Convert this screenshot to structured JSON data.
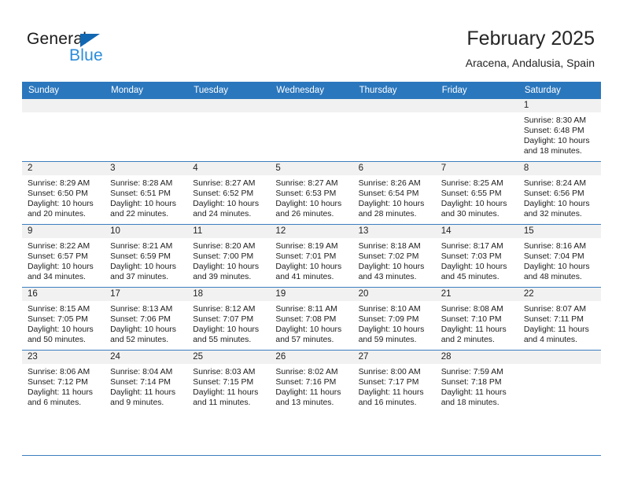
{
  "brand": {
    "name_part1": "General",
    "name_part2": "Blue",
    "triangle_color": "#1267b2",
    "blue_color": "#2a8cdb"
  },
  "header": {
    "title": "February 2025",
    "subtitle": "Aracena, Andalusia, Spain"
  },
  "theme": {
    "header_bg": "#2b77bd",
    "daynum_bg": "#f1f1f1",
    "grid_line": "#3d7fbf"
  },
  "weekdays": [
    "Sunday",
    "Monday",
    "Tuesday",
    "Wednesday",
    "Thursday",
    "Friday",
    "Saturday"
  ],
  "weeks": [
    [
      {
        "day": "",
        "sunrise": "",
        "sunset": "",
        "daylight_line1": "",
        "daylight_line2": ""
      },
      {
        "day": "",
        "sunrise": "",
        "sunset": "",
        "daylight_line1": "",
        "daylight_line2": ""
      },
      {
        "day": "",
        "sunrise": "",
        "sunset": "",
        "daylight_line1": "",
        "daylight_line2": ""
      },
      {
        "day": "",
        "sunrise": "",
        "sunset": "",
        "daylight_line1": "",
        "daylight_line2": ""
      },
      {
        "day": "",
        "sunrise": "",
        "sunset": "",
        "daylight_line1": "",
        "daylight_line2": ""
      },
      {
        "day": "",
        "sunrise": "",
        "sunset": "",
        "daylight_line1": "",
        "daylight_line2": ""
      },
      {
        "day": "1",
        "sunrise": "Sunrise: 8:30 AM",
        "sunset": "Sunset: 6:48 PM",
        "daylight_line1": "Daylight: 10 hours",
        "daylight_line2": "and 18 minutes."
      }
    ],
    [
      {
        "day": "2",
        "sunrise": "Sunrise: 8:29 AM",
        "sunset": "Sunset: 6:50 PM",
        "daylight_line1": "Daylight: 10 hours",
        "daylight_line2": "and 20 minutes."
      },
      {
        "day": "3",
        "sunrise": "Sunrise: 8:28 AM",
        "sunset": "Sunset: 6:51 PM",
        "daylight_line1": "Daylight: 10 hours",
        "daylight_line2": "and 22 minutes."
      },
      {
        "day": "4",
        "sunrise": "Sunrise: 8:27 AM",
        "sunset": "Sunset: 6:52 PM",
        "daylight_line1": "Daylight: 10 hours",
        "daylight_line2": "and 24 minutes."
      },
      {
        "day": "5",
        "sunrise": "Sunrise: 8:27 AM",
        "sunset": "Sunset: 6:53 PM",
        "daylight_line1": "Daylight: 10 hours",
        "daylight_line2": "and 26 minutes."
      },
      {
        "day": "6",
        "sunrise": "Sunrise: 8:26 AM",
        "sunset": "Sunset: 6:54 PM",
        "daylight_line1": "Daylight: 10 hours",
        "daylight_line2": "and 28 minutes."
      },
      {
        "day": "7",
        "sunrise": "Sunrise: 8:25 AM",
        "sunset": "Sunset: 6:55 PM",
        "daylight_line1": "Daylight: 10 hours",
        "daylight_line2": "and 30 minutes."
      },
      {
        "day": "8",
        "sunrise": "Sunrise: 8:24 AM",
        "sunset": "Sunset: 6:56 PM",
        "daylight_line1": "Daylight: 10 hours",
        "daylight_line2": "and 32 minutes."
      }
    ],
    [
      {
        "day": "9",
        "sunrise": "Sunrise: 8:22 AM",
        "sunset": "Sunset: 6:57 PM",
        "daylight_line1": "Daylight: 10 hours",
        "daylight_line2": "and 34 minutes."
      },
      {
        "day": "10",
        "sunrise": "Sunrise: 8:21 AM",
        "sunset": "Sunset: 6:59 PM",
        "daylight_line1": "Daylight: 10 hours",
        "daylight_line2": "and 37 minutes."
      },
      {
        "day": "11",
        "sunrise": "Sunrise: 8:20 AM",
        "sunset": "Sunset: 7:00 PM",
        "daylight_line1": "Daylight: 10 hours",
        "daylight_line2": "and 39 minutes."
      },
      {
        "day": "12",
        "sunrise": "Sunrise: 8:19 AM",
        "sunset": "Sunset: 7:01 PM",
        "daylight_line1": "Daylight: 10 hours",
        "daylight_line2": "and 41 minutes."
      },
      {
        "day": "13",
        "sunrise": "Sunrise: 8:18 AM",
        "sunset": "Sunset: 7:02 PM",
        "daylight_line1": "Daylight: 10 hours",
        "daylight_line2": "and 43 minutes."
      },
      {
        "day": "14",
        "sunrise": "Sunrise: 8:17 AM",
        "sunset": "Sunset: 7:03 PM",
        "daylight_line1": "Daylight: 10 hours",
        "daylight_line2": "and 45 minutes."
      },
      {
        "day": "15",
        "sunrise": "Sunrise: 8:16 AM",
        "sunset": "Sunset: 7:04 PM",
        "daylight_line1": "Daylight: 10 hours",
        "daylight_line2": "and 48 minutes."
      }
    ],
    [
      {
        "day": "16",
        "sunrise": "Sunrise: 8:15 AM",
        "sunset": "Sunset: 7:05 PM",
        "daylight_line1": "Daylight: 10 hours",
        "daylight_line2": "and 50 minutes."
      },
      {
        "day": "17",
        "sunrise": "Sunrise: 8:13 AM",
        "sunset": "Sunset: 7:06 PM",
        "daylight_line1": "Daylight: 10 hours",
        "daylight_line2": "and 52 minutes."
      },
      {
        "day": "18",
        "sunrise": "Sunrise: 8:12 AM",
        "sunset": "Sunset: 7:07 PM",
        "daylight_line1": "Daylight: 10 hours",
        "daylight_line2": "and 55 minutes."
      },
      {
        "day": "19",
        "sunrise": "Sunrise: 8:11 AM",
        "sunset": "Sunset: 7:08 PM",
        "daylight_line1": "Daylight: 10 hours",
        "daylight_line2": "and 57 minutes."
      },
      {
        "day": "20",
        "sunrise": "Sunrise: 8:10 AM",
        "sunset": "Sunset: 7:09 PM",
        "daylight_line1": "Daylight: 10 hours",
        "daylight_line2": "and 59 minutes."
      },
      {
        "day": "21",
        "sunrise": "Sunrise: 8:08 AM",
        "sunset": "Sunset: 7:10 PM",
        "daylight_line1": "Daylight: 11 hours",
        "daylight_line2": "and 2 minutes."
      },
      {
        "day": "22",
        "sunrise": "Sunrise: 8:07 AM",
        "sunset": "Sunset: 7:11 PM",
        "daylight_line1": "Daylight: 11 hours",
        "daylight_line2": "and 4 minutes."
      }
    ],
    [
      {
        "day": "23",
        "sunrise": "Sunrise: 8:06 AM",
        "sunset": "Sunset: 7:12 PM",
        "daylight_line1": "Daylight: 11 hours",
        "daylight_line2": "and 6 minutes."
      },
      {
        "day": "24",
        "sunrise": "Sunrise: 8:04 AM",
        "sunset": "Sunset: 7:14 PM",
        "daylight_line1": "Daylight: 11 hours",
        "daylight_line2": "and 9 minutes."
      },
      {
        "day": "25",
        "sunrise": "Sunrise: 8:03 AM",
        "sunset": "Sunset: 7:15 PM",
        "daylight_line1": "Daylight: 11 hours",
        "daylight_line2": "and 11 minutes."
      },
      {
        "day": "26",
        "sunrise": "Sunrise: 8:02 AM",
        "sunset": "Sunset: 7:16 PM",
        "daylight_line1": "Daylight: 11 hours",
        "daylight_line2": "and 13 minutes."
      },
      {
        "day": "27",
        "sunrise": "Sunrise: 8:00 AM",
        "sunset": "Sunset: 7:17 PM",
        "daylight_line1": "Daylight: 11 hours",
        "daylight_line2": "and 16 minutes."
      },
      {
        "day": "28",
        "sunrise": "Sunrise: 7:59 AM",
        "sunset": "Sunset: 7:18 PM",
        "daylight_line1": "Daylight: 11 hours",
        "daylight_line2": "and 18 minutes."
      },
      {
        "day": "",
        "sunrise": "",
        "sunset": "",
        "daylight_line1": "",
        "daylight_line2": ""
      }
    ]
  ]
}
